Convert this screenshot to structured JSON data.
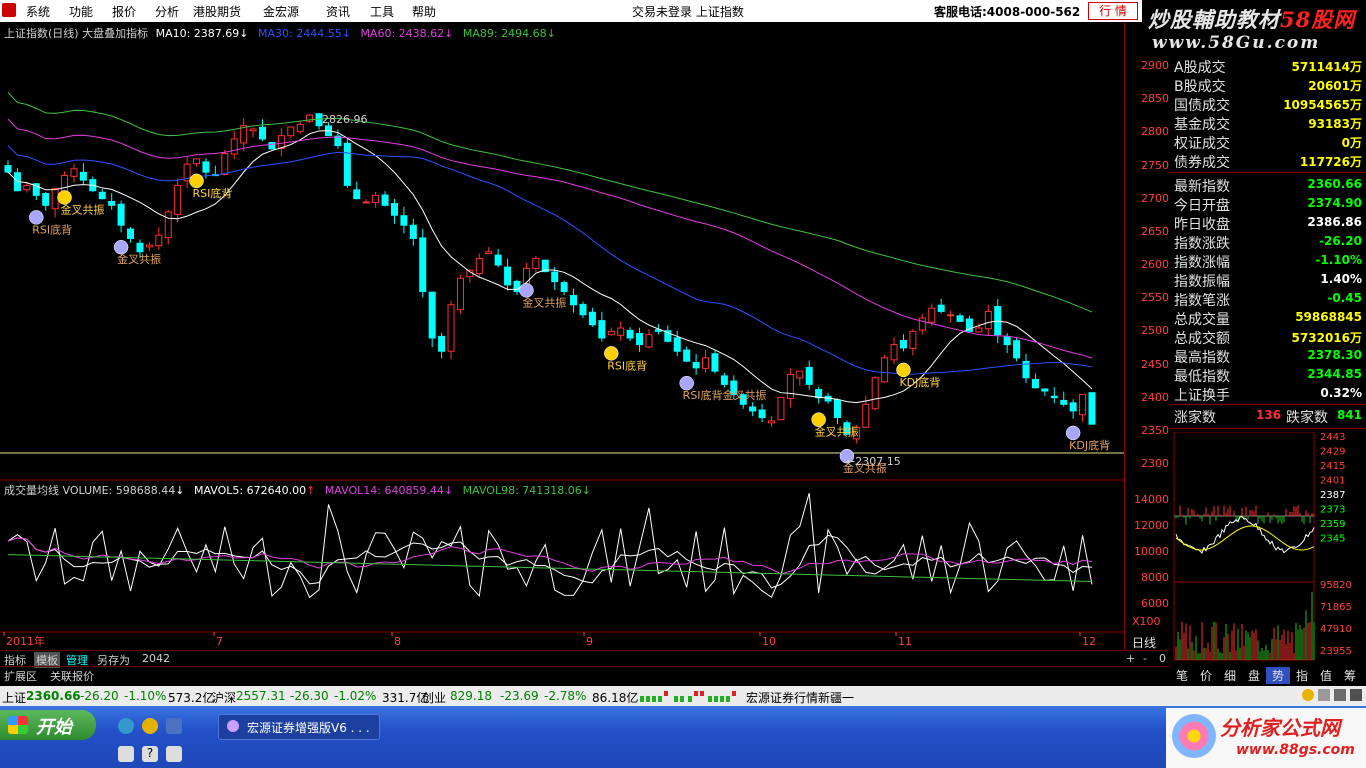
{
  "menu": {
    "items": [
      "系统",
      "功能",
      "报价",
      "分析",
      "港股期货",
      "金宏源",
      "资讯",
      "工具",
      "帮助"
    ],
    "login_status": "交易未登录 上证指数",
    "hotline": "客服电话:4008-000-562",
    "quote_button": "行 情"
  },
  "brand": {
    "title_a": "炒股輔助教材",
    "title_b": "58股网",
    "url": "www.58Gu.com"
  },
  "chart": {
    "legend_main": {
      "title": "上证指数(日线) 大盘叠加指标",
      "ma10": "MA10: 2387.69",
      "ma30": "MA30: 2444.55",
      "ma60": "MA60: 2438.62",
      "ma89": "MA89: 2494.68"
    },
    "legend_volume": {
      "title": "成交量均线 VOLUME: 598688.44",
      "mavol5": "MAVOL5: 672640.00",
      "mavol14": "MAVOL14: 640859.44",
      "mavol98": "MAVOL98: 741318.06"
    },
    "high_mark": "2826.96",
    "low_mark": "←2307.15",
    "signals": [
      {
        "text": "RSI底背"
      },
      {
        "text": "金叉共振"
      },
      {
        "text": "金叉共振"
      },
      {
        "text": "RSI底背"
      },
      {
        "text": "金叉共振"
      },
      {
        "text": "RSI底背"
      },
      {
        "text": "RSI底背金叉共振"
      },
      {
        "text": "金叉共振"
      },
      {
        "text": "金叉共振"
      },
      {
        "text": "KDJ底背"
      },
      {
        "text": "KDJ底背"
      }
    ],
    "x_labels": [
      "2011年",
      "7",
      "8",
      "9",
      "10",
      "11",
      "12"
    ],
    "x100_label": "X100"
  },
  "chart_data": {
    "type": "candlestick",
    "price_axis": [
      2900,
      2850,
      2800,
      2750,
      2700,
      2650,
      2600,
      2550,
      2500,
      2450,
      2400,
      2350,
      2300
    ],
    "volume_axis": [
      14000,
      12000,
      10000,
      8000,
      6000
    ],
    "close": [
      2740,
      2712,
      2720,
      2705,
      2690,
      2715,
      2735,
      2745,
      2728,
      2712,
      2700,
      2690,
      2660,
      2640,
      2620,
      2630,
      2645,
      2680,
      2720,
      2752,
      2760,
      2740,
      2735,
      2768,
      2790,
      2810,
      2805,
      2790,
      2775,
      2795,
      2808,
      2812,
      2826,
      2810,
      2795,
      2780,
      2720,
      2700,
      2695,
      2705,
      2690,
      2675,
      2660,
      2640,
      2560,
      2490,
      2470,
      2540,
      2580,
      2592,
      2610,
      2620,
      2600,
      2570,
      2560,
      2595,
      2610,
      2590,
      2575,
      2560,
      2540,
      2525,
      2510,
      2490,
      2500,
      2505,
      2490,
      2480,
      2495,
      2500,
      2485,
      2470,
      2455,
      2445,
      2460,
      2440,
      2420,
      2405,
      2390,
      2380,
      2370,
      2365,
      2400,
      2435,
      2440,
      2420,
      2400,
      2395,
      2370,
      2345,
      2355,
      2390,
      2430,
      2460,
      2480,
      2475,
      2500,
      2520,
      2535,
      2530,
      2525,
      2515,
      2500,
      2505,
      2530,
      2495,
      2480,
      2460,
      2430,
      2415,
      2410,
      2400,
      2390,
      2380,
      2405,
      2360
    ]
  },
  "ticks_price": [
    "2900",
    "2850",
    "2800",
    "2750",
    "2700",
    "2650",
    "2600",
    "2550",
    "2500",
    "2450",
    "2400",
    "2350",
    "2300"
  ],
  "ticks_volume": [
    "14000",
    "12000",
    "10000",
    "8000",
    "6000"
  ],
  "mini_chart": {
    "price_ticks": [
      "2443",
      "2429",
      "2415",
      "2401",
      "2387",
      "2373",
      "2359",
      "2345"
    ],
    "volume_ticks": [
      "95820",
      "71865",
      "47910",
      "23955"
    ]
  },
  "market": [
    {
      "label": "A股成交",
      "value": "5711414万",
      "color": "#ffff00"
    },
    {
      "label": "B股成交",
      "value": "20601万",
      "color": "#ffff00"
    },
    {
      "label": "国债成交",
      "value": "10954565万",
      "color": "#ffff00"
    },
    {
      "label": "基金成交",
      "value": "93183万",
      "color": "#ffff00"
    },
    {
      "label": "权证成交",
      "value": "0万",
      "color": "#ffff00"
    },
    {
      "label": "债券成交",
      "value": "117726万",
      "color": "#ffff00"
    }
  ],
  "index_info": [
    {
      "label": "最新指数",
      "value": "2360.66",
      "color": "#00ff00"
    },
    {
      "label": "今日开盘",
      "value": "2374.90",
      "color": "#00ff00"
    },
    {
      "label": "昨日收盘",
      "value": "2386.86",
      "color": "#ffffff"
    },
    {
      "label": "指数涨跌",
      "value": "-26.20",
      "color": "#00ff00"
    },
    {
      "label": "指数涨幅",
      "value": "-1.10%",
      "color": "#00ff00"
    },
    {
      "label": "指数振幅",
      "value": "1.40%",
      "color": "#ffffff"
    },
    {
      "label": "指数笔涨",
      "value": "-0.45",
      "color": "#00ff00"
    },
    {
      "label": "总成交量",
      "value": "59868845",
      "color": "#ffff00"
    },
    {
      "label": "总成交额",
      "value": "5732016万",
      "color": "#ffff00"
    },
    {
      "label": "最高指数",
      "value": "2378.30",
      "color": "#00ff00"
    },
    {
      "label": "最低指数",
      "value": "2344.85",
      "color": "#00ff00"
    },
    {
      "label": "上证换手",
      "value": "0.32%",
      "color": "#ffffff"
    }
  ],
  "breadth": {
    "up_label": "涨家数",
    "up_value": "136",
    "down_label": "跌家数",
    "down_value": "841"
  },
  "bottom_tabs": {
    "row1": [
      "指标",
      "模板",
      "管理",
      "另存为",
      "2042"
    ],
    "row1_right": [
      "+",
      "-",
      "0"
    ],
    "period": "日线",
    "row2": [
      "扩展区",
      "关联报价"
    ],
    "right_tabs": [
      "笔",
      "价",
      "细",
      "盘",
      "势",
      "指",
      "值",
      "筹"
    ]
  },
  "status": {
    "sh_label": "上证",
    "sh_price": "2360.66",
    "sh_chg": "-26.20",
    "sh_pct": "-1.10%",
    "sh_amt": "573.2亿",
    "hs_label": "沪深",
    "hs_price": "2557.31",
    "hs_chg": "-26.30",
    "hs_pct": "-1.02%",
    "hs_amt": "331.7亿",
    "cy_label": "创业",
    "cy_price": "829.18",
    "cy_chg": "-23.69",
    "cy_pct": "-2.78%",
    "cy_amt": "86.18亿",
    "news": "宏源证券行情新疆一"
  },
  "taskbar": {
    "start": "开始",
    "task": "宏源证券增强版V6 . . .",
    "watermark_title": "分析家公式网",
    "watermark_url": "www.88gs.com"
  },
  "colors": {
    "up": "#ff3030",
    "down": "#00ffff",
    "ma10": "#ffffff",
    "ma30": "#3050ff",
    "ma60": "#e040e0",
    "ma89": "#40c040"
  }
}
